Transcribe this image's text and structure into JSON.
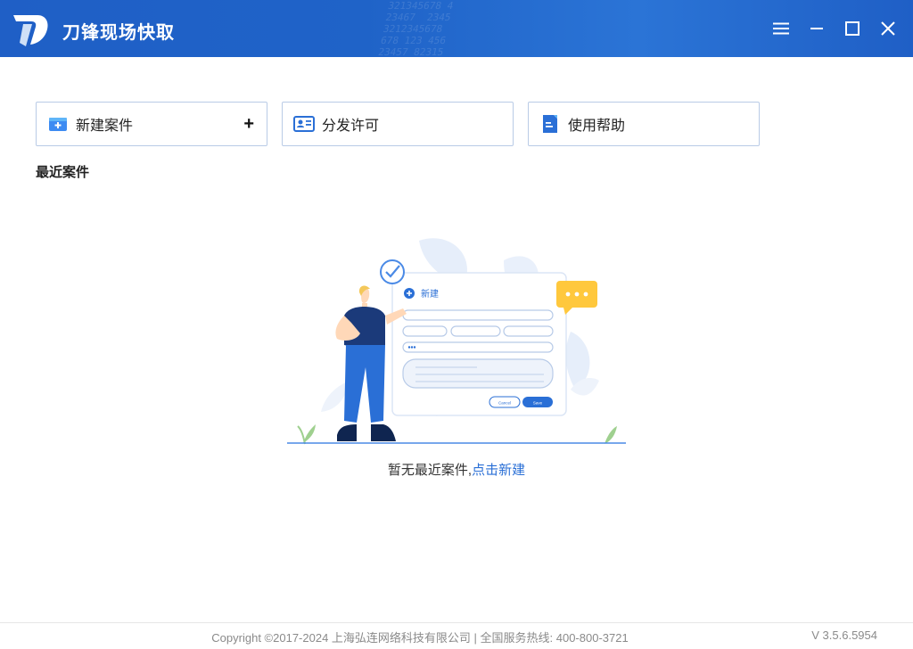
{
  "titlebar": {
    "app_title": "刀锋现场快取",
    "menu_icon": "hamburger-menu-icon",
    "minimize_icon": "minimize-icon",
    "maximize_icon": "maximize-icon",
    "close_icon": "close-icon"
  },
  "actions": [
    {
      "label": "新建案件",
      "icon": "new-case-icon",
      "suffix": "+"
    },
    {
      "label": "分发许可",
      "icon": "license-card-icon"
    },
    {
      "label": "使用帮助",
      "icon": "help-document-icon"
    }
  ],
  "recent": {
    "title": "最近案件",
    "illustration": {
      "new_label": "新建",
      "cancel_label": "Cancel",
      "save_label": "Save"
    },
    "empty_text": "暂无最近案件,",
    "empty_link": "点击新建"
  },
  "footer": {
    "copyright": "Copyright ©2017-2024 上海弘连网络科技有限公司 | 全国服务热线: 400-800-3721",
    "version": "V 3.5.6.5954"
  },
  "colors": {
    "titlebar": "#1f63c8",
    "accent": "#2a6fd6",
    "card_border": "#b9cbe6"
  }
}
